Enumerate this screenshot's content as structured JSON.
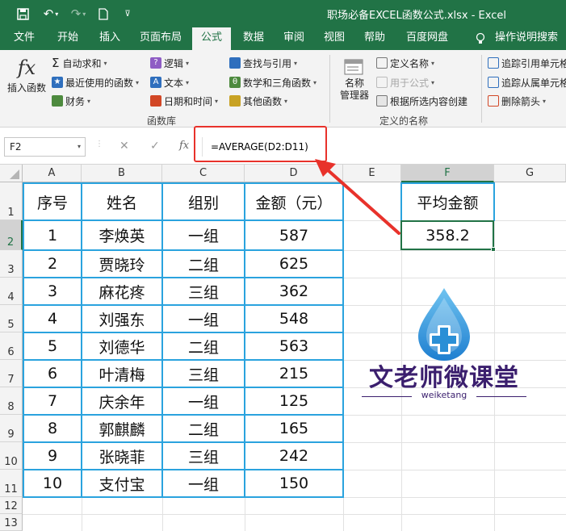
{
  "title_bar": {
    "title": "职场必备EXCEL函数公式.xlsx  -  Excel"
  },
  "menu_tabs": [
    "文件",
    "开始",
    "插入",
    "页面布局",
    "公式",
    "数据",
    "审阅",
    "视图",
    "帮助",
    "百度网盘",
    "操作说明搜索"
  ],
  "active_tab": "公式",
  "ribbon": {
    "insert_function": "插入函数",
    "autosum": "自动求和",
    "recent": "最近使用的函数",
    "financial": "财务",
    "logical": "逻辑",
    "text": "文本",
    "datetime": "日期和时间",
    "lookup": "查找与引用",
    "math": "数学和三角函数",
    "more": "其他函数",
    "library_group": "函数库",
    "name_manager_1": "名称",
    "name_manager_2": "管理器",
    "define_name": "定义名称",
    "use_in_formula": "用于公式",
    "create_from_selection": "根据所选内容创建",
    "defined_names_group": "定义的名称",
    "trace_precedents": "追踪引用单元格",
    "trace_dependents": "追踪从属单元格",
    "remove_arrows": "删除箭头"
  },
  "formula_bar": {
    "name_box": "F2",
    "cancel": "✕",
    "enter": "✓",
    "fx": "fx",
    "formula": "=AVERAGE(D2:D11)"
  },
  "columns": [
    "A",
    "B",
    "C",
    "D",
    "E",
    "F",
    "G"
  ],
  "rows": [
    "1",
    "2",
    "3",
    "4",
    "5",
    "6",
    "7",
    "8",
    "9",
    "10",
    "11",
    "12",
    "13"
  ],
  "table": {
    "headers": [
      "序号",
      "姓名",
      "组别",
      "金额（元）"
    ],
    "rows": [
      [
        "1",
        "李焕英",
        "一组",
        "587"
      ],
      [
        "2",
        "贾晓玲",
        "二组",
        "625"
      ],
      [
        "3",
        "麻花疼",
        "三组",
        "362"
      ],
      [
        "4",
        "刘强东",
        "一组",
        "548"
      ],
      [
        "5",
        "刘德华",
        "二组",
        "563"
      ],
      [
        "6",
        "叶清梅",
        "三组",
        "215"
      ],
      [
        "7",
        "庆余年",
        "一组",
        "125"
      ],
      [
        "8",
        "郭麒麟",
        "二组",
        "165"
      ],
      [
        "9",
        "张晓菲",
        "三组",
        "242"
      ],
      [
        "10",
        "支付宝",
        "一组",
        "150"
      ]
    ]
  },
  "result": {
    "header": "平均金额",
    "value": "358.2"
  },
  "watermark": {
    "brand": "文老师微课堂",
    "sub": "weiketang"
  },
  "colors": {
    "excel_green": "#217346",
    "table_border": "#2aa3de",
    "highlight_red": "#e8322b",
    "brand_purple": "#3b1f6e",
    "drop_blue": "#2a8fd6"
  }
}
